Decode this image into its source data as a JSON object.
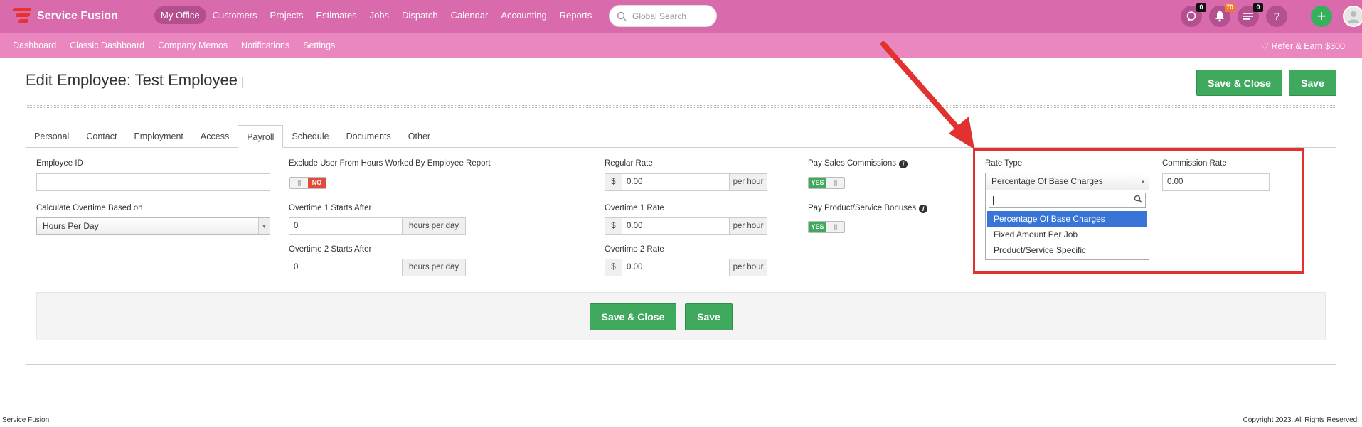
{
  "app": {
    "brand": "Service Fusion",
    "main_nav": [
      "My Office",
      "Customers",
      "Projects",
      "Estimates",
      "Jobs",
      "Dispatch",
      "Calendar",
      "Accounting",
      "Reports"
    ],
    "active_nav": "My Office",
    "search_placeholder": "Global Search",
    "badges": {
      "chat": "0",
      "notifications": "70",
      "tasks": "0"
    },
    "help": "?",
    "add": "+",
    "sub_nav": [
      "Dashboard",
      "Classic Dashboard",
      "Company Memos",
      "Notifications",
      "Settings"
    ],
    "refer": "Refer & Earn $300"
  },
  "page": {
    "title": "Edit Employee: Test Employee",
    "save_close": "Save & Close",
    "save": "Save"
  },
  "tabs": [
    "Personal",
    "Contact",
    "Employment",
    "Access",
    "Payroll",
    "Schedule",
    "Documents",
    "Other"
  ],
  "active_tab": "Payroll",
  "form": {
    "employee_id": {
      "label": "Employee ID",
      "value": ""
    },
    "overtime_basis": {
      "label": "Calculate Overtime Based on",
      "value": "Hours Per Day"
    },
    "exclude": {
      "label": "Exclude User From Hours Worked By Employee Report",
      "value": "NO"
    },
    "ot1_after": {
      "label": "Overtime 1 Starts After",
      "value": "0",
      "unit": "hours per day"
    },
    "ot2_after": {
      "label": "Overtime 2 Starts After",
      "value": "0",
      "unit": "hours per day"
    },
    "regular_rate": {
      "label": "Regular Rate",
      "prefix": "$",
      "value": "0.00",
      "unit": "per hour"
    },
    "ot1_rate": {
      "label": "Overtime 1 Rate",
      "prefix": "$",
      "value": "0.00",
      "unit": "per hour"
    },
    "ot2_rate": {
      "label": "Overtime 2 Rate",
      "prefix": "$",
      "value": "0.00",
      "unit": "per hour"
    },
    "pay_sales": {
      "label": "Pay Sales Commissions",
      "value": "YES"
    },
    "pay_bonuses": {
      "label": "Pay Product/Service Bonuses",
      "value": "YES"
    },
    "rate_type": {
      "label": "Rate Type",
      "value": "Percentage Of Base Charges",
      "options": [
        "Percentage Of Base Charges",
        "Fixed Amount Per Job",
        "Product/Service Specific"
      ]
    },
    "commission_rate": {
      "label": "Commission Rate",
      "value": "0.00"
    }
  },
  "footer": {
    "left": "Service Fusion",
    "right": "Copyright 2023. All Rights Reserved."
  },
  "colors": {
    "topbar": "#d96aac",
    "subbar": "#ea87c0",
    "green": "#3fa95e",
    "annotation": "#e2322f",
    "highlight": "#3875d7"
  }
}
